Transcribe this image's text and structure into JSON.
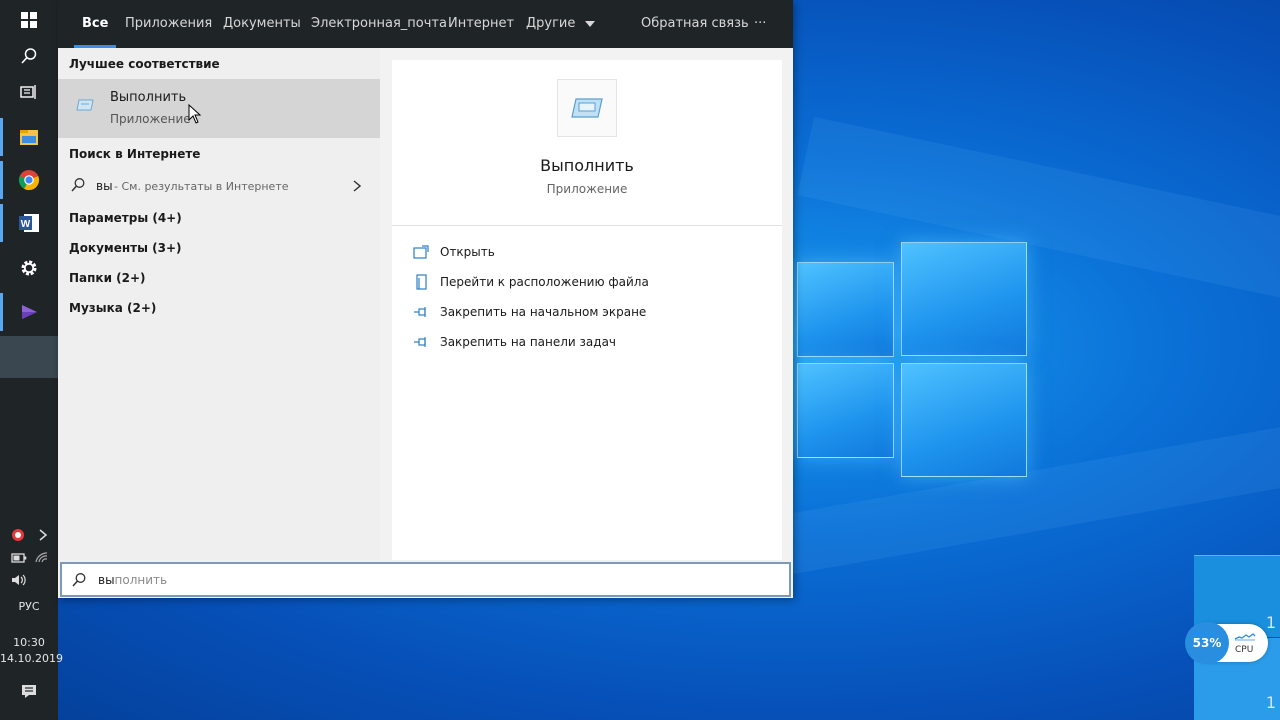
{
  "tabs": {
    "all": "Все",
    "apps": "Приложения",
    "docs": "Документы",
    "email": "Электронная_почта",
    "web": "Интернет",
    "other": "Другие",
    "feedback": "Обратная связь",
    "more": "···"
  },
  "best_match": {
    "heading": "Лучшее соответствие",
    "title": "Выполнить",
    "subtitle": "Приложение"
  },
  "web_search": {
    "heading": "Поиск в Интернете",
    "query": "вы",
    "suffix": " - См. результаты в Интернете"
  },
  "categories": [
    "Параметры (4+)",
    "Документы (3+)",
    "Папки (2+)",
    "Музыка (2+)"
  ],
  "preview": {
    "title": "Выполнить",
    "subtitle": "Приложение",
    "actions": [
      "Открыть",
      "Перейти к расположению файла",
      "Закрепить на начальном экране",
      "Закрепить на панели задач"
    ]
  },
  "search": {
    "typed": "вы",
    "completion": "полнить"
  },
  "taskbar": {
    "language": "РУС",
    "time": "10:30",
    "date": "14.10.2019"
  },
  "cpu_widget": {
    "percent": "53%",
    "label": "CPU",
    "counter_top": "1",
    "counter_bottom": "1"
  },
  "icons": {
    "start": "windows-logo-icon",
    "search": "search-icon",
    "task_view": "task-view-icon",
    "explorer": "file-explorer-icon",
    "chrome": "chrome-icon",
    "word": "word-icon",
    "settings": "gear-icon",
    "media": "media-player-icon"
  }
}
